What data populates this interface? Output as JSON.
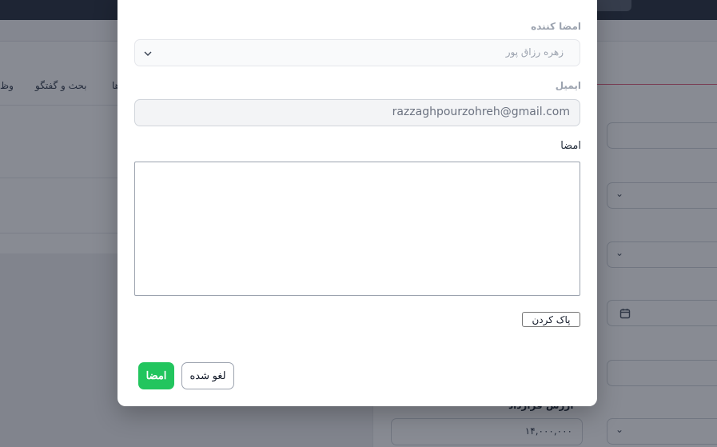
{
  "background": {
    "tabs": [
      "بحث و گفتگو",
      "ها",
      "وظ"
    ],
    "amount_label": "ارزش قرارداد",
    "amount_value": "۱۴,۰۰۰,۰۰۰"
  },
  "modal": {
    "signer_label": "امضا کننده",
    "signer_value": "زهره رزاق پور",
    "email_label": "ایمیل",
    "email_value": "razzaghpourzohreh@gmail.com",
    "signature_label": "امضا",
    "clear_label": "پاک کردن",
    "cancel_label": "لغو شده",
    "sign_label": "امضا"
  },
  "colors": {
    "primary": "#22c55e",
    "accent_line": "#e0607e",
    "topbar": "#2b3340"
  }
}
